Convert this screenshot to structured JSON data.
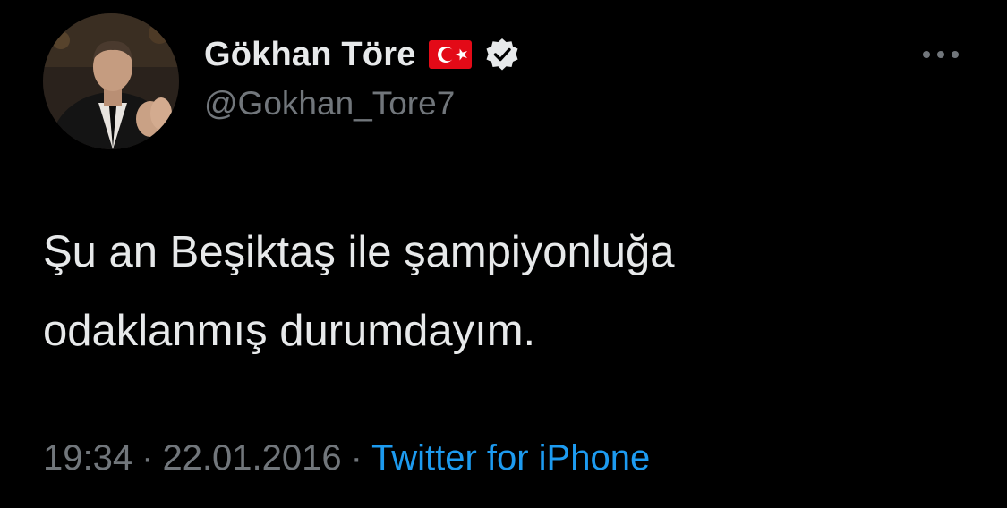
{
  "tweet": {
    "author": {
      "display_name": "Gökhan Töre",
      "handle": "@Gokhan_Tore7",
      "flag_icon": "turkey-flag-icon",
      "verified_icon": "verified-badge-icon",
      "avatar_icon": "profile-photo-avatar"
    },
    "more_icon": "more-options-icon",
    "text": "Şu an Beşiktaş ile şampiyonluğa\nodaklanmış durumdayım.",
    "time": "19:34",
    "separator": "·",
    "date": "22.01.2016",
    "source": "Twitter for iPhone"
  },
  "colors": {
    "background": "#000000",
    "primary_text": "#e7e9ea",
    "secondary_text": "#71767b",
    "link": "#1d9bf0",
    "flag_red": "#e30a17"
  }
}
